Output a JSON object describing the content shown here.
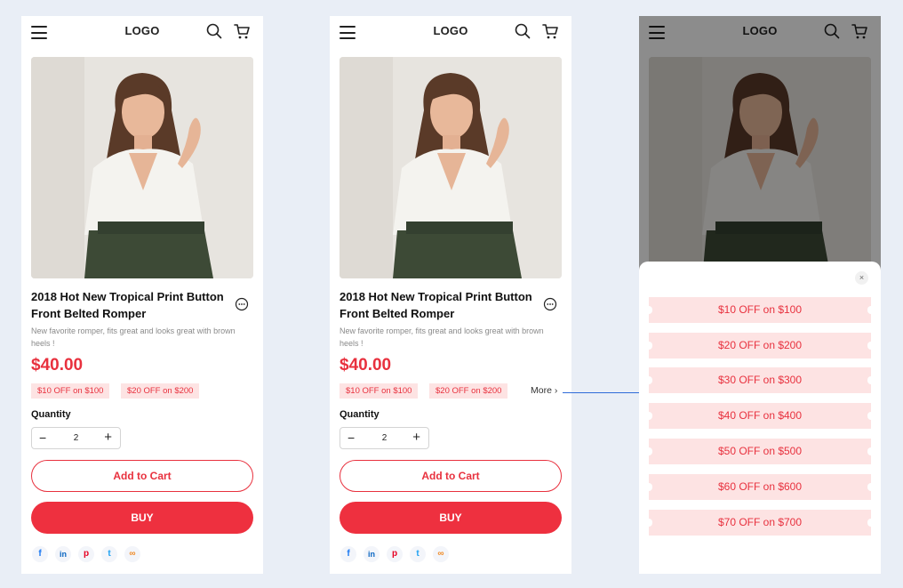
{
  "header": {
    "logo": "LOGO"
  },
  "product": {
    "title": "2018 Hot New Tropical Print Button Front Belted Romper",
    "description": "New favorite romper, fits great and looks great with brown heels !",
    "price": "$40.00"
  },
  "coupons": [
    "$10 OFF on $100",
    "$20 OFF on $200"
  ],
  "more_label": "More ›",
  "quantity": {
    "label": "Quantity",
    "value": "2",
    "minus": "−",
    "plus": "+"
  },
  "buttons": {
    "add_to_cart": "Add to Cart",
    "buy": "BUY"
  },
  "share": {
    "facebook": "f",
    "linkedin": "in",
    "pinterest": "p",
    "twitter": "t",
    "link": "∞"
  },
  "sheet": {
    "close": "×",
    "coupons": [
      "$10 OFF on $100",
      "$20 OFF on $200",
      "$30 OFF on $300",
      "$40 OFF on $400",
      "$50 OFF on $500",
      "$60 OFF on $600",
      "$70 OFF on $700"
    ]
  },
  "colors": {
    "accent": "#e8313e",
    "buy_button": "#ee303f",
    "coupon_bg": "#fde3e3",
    "page_bg": "#e9eef6",
    "connector": "#2e6bd9"
  }
}
